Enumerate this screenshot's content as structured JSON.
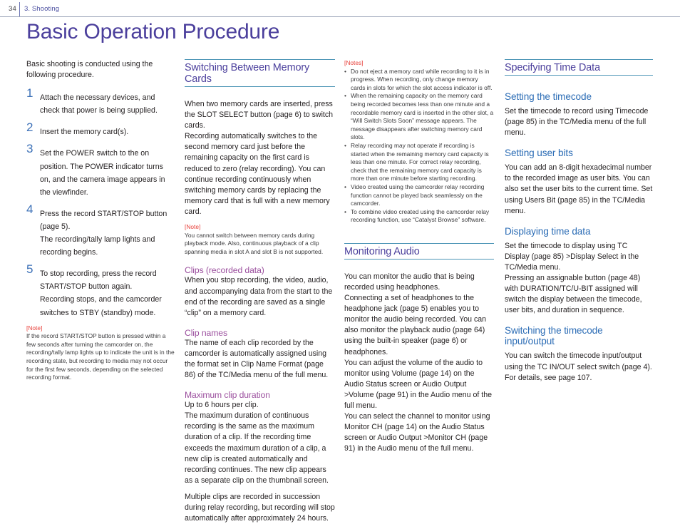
{
  "header": {
    "page_number": "34",
    "chapter": "3. Shooting"
  },
  "title": "Basic Operation Procedure",
  "colors": {
    "title_purple": "#4b3f9c",
    "section_rule_teal": "#4a94b5",
    "subhead_purple": "#9b4f9e",
    "subhead_blue": "#2b6cb5",
    "step_number_blue": "#3e72b8",
    "note_red": "#e8403a",
    "body_black": "#231f20"
  },
  "column1": {
    "intro": "Basic shooting is conducted using the following procedure.",
    "steps": [
      {
        "num": "1",
        "text": "Attach the necessary devices, and check that power is being supplied."
      },
      {
        "num": "2",
        "text": "Insert the memory card(s)."
      },
      {
        "num": "3",
        "text": "Set the POWER switch to the on position. The POWER indicator turns on, and the camera image appears in the viewfinder."
      },
      {
        "num": "4",
        "text": "Press the record START/STOP button (page 5).\nThe recording/tally lamp lights and recording begins."
      },
      {
        "num": "5",
        "text": "To stop recording, press the record START/STOP button again.\nRecording stops, and the camcorder switches to STBY (standby) mode."
      }
    ],
    "note_label": "[Note]",
    "note_body": "If the record START/STOP button is pressed within a few seconds after turning the camcorder on, the recording/tally lamp lights up to indicate the unit is in the recording state, but recording to media may not occur for the first few seconds, depending on the selected recording format."
  },
  "column2": {
    "section_head": "Switching Between Memory Cards",
    "para1": "When two memory cards are inserted, press the SLOT SELECT button (page 6) to switch cards.",
    "para2": "Recording automatically switches to the second memory card just before the remaining capacity on the first card is reduced to zero (relay recording). You can continue recording continuously when switching memory cards by replacing the memory card that is full with a new memory card.",
    "note_label": "[Note]",
    "note_body": "You cannot switch between memory cards during playback mode. Also, continuous playback of a clip spanning media in slot A and slot B is not supported.",
    "sub1_head": "Clips (recorded data)",
    "sub1_body": "When you stop recording, the video, audio, and accompanying data from the start to the end of the recording are saved as a single “clip” on a memory card.",
    "sub2_head": "Clip names",
    "sub2_body": "The name of each clip recorded by the camcorder is automatically assigned using the format set in Clip Name Format (page 86) of the TC/Media menu of the full menu.",
    "sub3_head": "Maximum clip duration",
    "sub3_body1": "Up to 6 hours per clip.",
    "sub3_body2": "The maximum duration of continuous recording is the same as the maximum duration of a clip. If the recording time exceeds the maximum duration of a clip, a new clip is created automatically and recording continues. The new clip appears as a separate clip on the thumbnail screen.",
    "sub3_body3": "Multiple clips are recorded in succession during relay recording, but recording will stop automatically after approximately 24 hours."
  },
  "column3": {
    "notes_label": "[Notes]",
    "notes": [
      "Do not eject a memory card while recording to it is in progress. When recording, only change memory cards in slots for which the slot access indicator is off.",
      "When the remaining capacity on the memory card being recorded becomes less than one minute and a recordable memory card is inserted in the other slot, a “Will Switch Slots Soon” message appears. The message disappears after switching memory card slots.",
      "Relay recording may not operate if recording is started when the remaining memory card capacity is less than one minute. For correct relay recording, check that the remaining memory card capacity is more than one minute before starting recording.",
      "Video created using the camcorder relay recording function cannot be played back seamlessly on the camcorder.",
      "To combine video created using the camcorder relay recording function, use “Catalyst Browse” software."
    ],
    "section_head": "Monitoring Audio",
    "para1": "You can monitor the audio that is being recorded using headphones.",
    "para2": "Connecting a set of headphones to the headphone jack (page 5) enables you to monitor the audio being recorded. You can also monitor the playback audio (page 64) using the built-in speaker (page 6) or headphones.",
    "para3": "You can adjust the volume of the audio to monitor using Volume (page 14) on the Audio Status screen or Audio Output >Volume (page 91) in the Audio menu of the full menu.",
    "para4": "You can select the channel to monitor using Monitor CH (page 14) on the Audio Status screen or Audio Output >Monitor CH (page 91) in the Audio menu of the full menu."
  },
  "column4": {
    "section_head": "Specifying Time Data",
    "sub1_head": "Setting the timecode",
    "sub1_body": "Set the timecode to record using Timecode (page 85) in the TC/Media menu of the full menu.",
    "sub2_head": "Setting user bits",
    "sub2_body": "You can add an 8-digit hexadecimal number to the recorded image as user bits. You can also set the user bits to the current time. Set using Users Bit (page 85) in the TC/Media menu.",
    "sub3_head": "Displaying time data",
    "sub3_body1": "Set the timecode to display using TC Display (page 85) >Display Select in the TC/Media menu.",
    "sub3_body2": "Pressing an assignable button (page 48) with DURATION/TC/U-BIT assigned will switch the display between the timecode, user bits, and duration in sequence.",
    "sub4_head": "Switching the timecode input/output",
    "sub4_body1": "You can switch the timecode input/output using the TC IN/OUT select switch (page 4).",
    "sub4_body2": "For details, see page 107."
  }
}
